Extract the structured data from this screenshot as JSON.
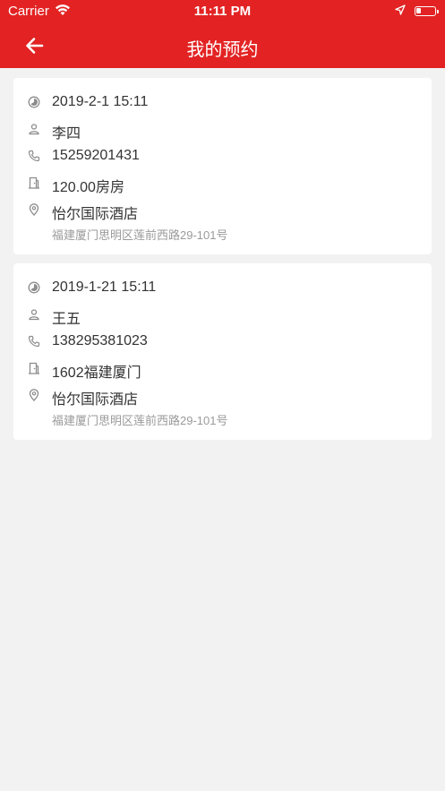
{
  "status_bar": {
    "carrier": "Carrier",
    "time": "11:11 PM"
  },
  "nav": {
    "title": "我的预约"
  },
  "colors": {
    "brand_red": "#e32323",
    "page_bg": "#f2f2f2",
    "icon_gray": "#8c8c8c",
    "secondary_text": "#9a9a9a"
  },
  "reservations": [
    {
      "datetime": "2019-2-1 15:11",
      "name": "李四",
      "phone": "15259201431",
      "room": "120.00房房",
      "hotel": "怡尔国际酒店",
      "address": "福建厦门思明区莲前西路29-101号"
    },
    {
      "datetime": "2019-1-21 15:11",
      "name": "王五",
      "phone": "138295381023",
      "room": "1602福建厦门",
      "hotel": "怡尔国际酒店",
      "address": "福建厦门思明区莲前西路29-101号"
    }
  ]
}
